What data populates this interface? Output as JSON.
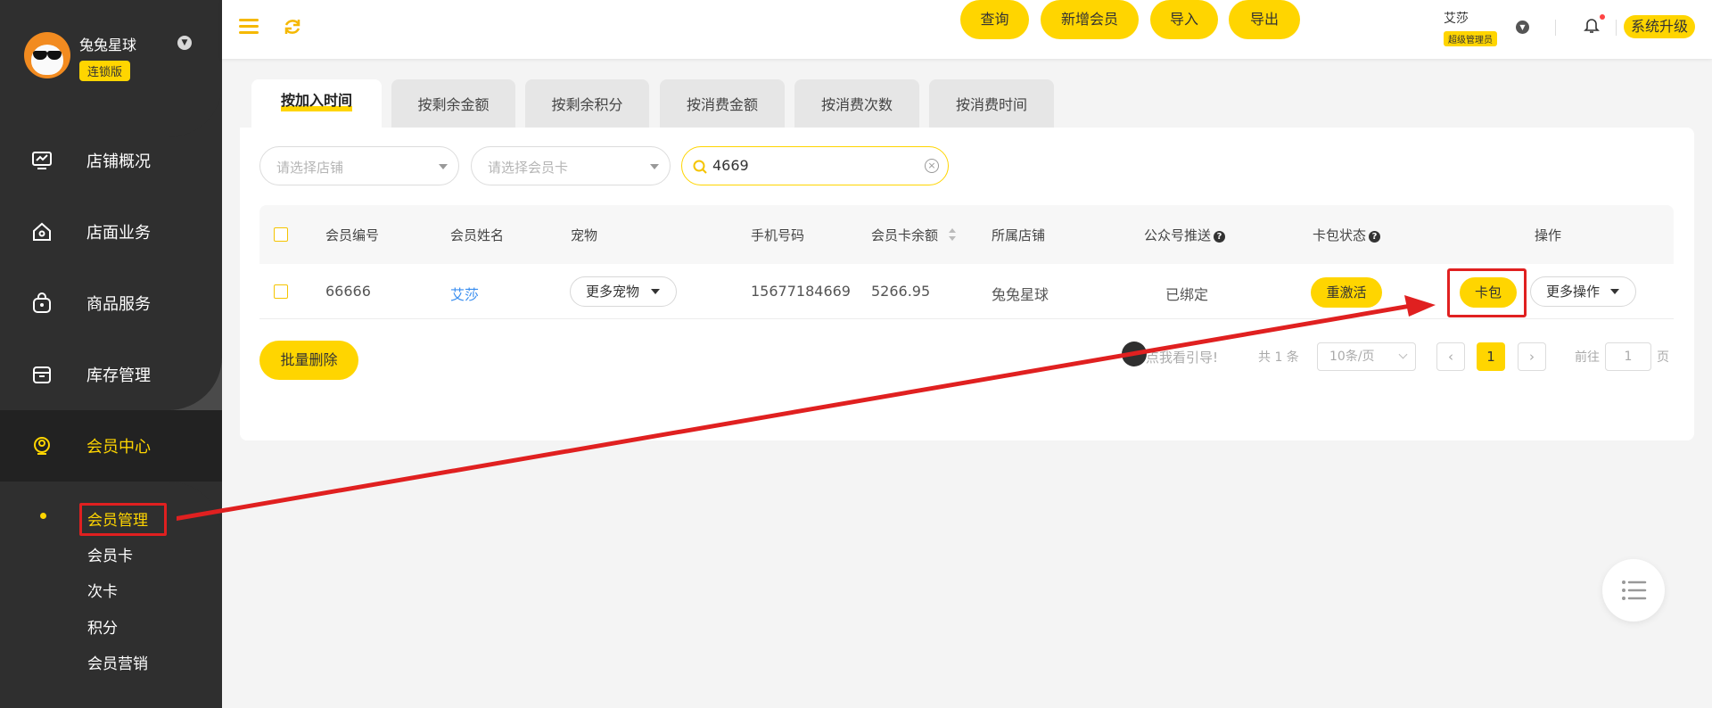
{
  "brand": {
    "name": "兔兔星球",
    "badge": "连锁版"
  },
  "menu": [
    {
      "label": "店铺概况",
      "icon": "monitor-icon"
    },
    {
      "label": "店面业务",
      "icon": "house-icon"
    },
    {
      "label": "商品服务",
      "icon": "bag-icon"
    },
    {
      "label": "库存管理",
      "icon": "box-icon"
    },
    {
      "label": "会员中心",
      "icon": "member-icon"
    }
  ],
  "submenu": [
    "会员管理",
    "会员卡",
    "次卡",
    "积分",
    "会员营销"
  ],
  "header": {
    "user_name": "艾莎",
    "user_role": "超级管理员",
    "upgrade": "系统升级"
  },
  "tabs": [
    "按加入时间",
    "按剩余金额",
    "按剩余积分",
    "按消费金额",
    "按消费次数",
    "按消费时间"
  ],
  "filters": {
    "store_placeholder": "请选择店铺",
    "card_placeholder": "请选择会员卡",
    "search_value": "4669",
    "query": "查询",
    "add_member": "新增会员",
    "import": "导入",
    "export": "导出"
  },
  "table": {
    "headers": [
      "会员编号",
      "会员姓名",
      "宠物",
      "手机号码",
      "会员卡余额",
      "所属店铺",
      "公众号推送",
      "卡包状态",
      "操作"
    ],
    "row": {
      "id": "66666",
      "name": "艾莎",
      "pets": "更多宠物",
      "phone": "15677184669",
      "balance": "5266.95",
      "store": "兔兔星球",
      "push": "已绑定",
      "card_status": "重激活",
      "card_pack": "卡包",
      "more_ops": "更多操作"
    }
  },
  "bulk_delete": "批量删除",
  "pagination": {
    "guide": "点我看引导!",
    "total": "共 1 条",
    "page_size": "10条/页",
    "current": "1",
    "goto_label": "前往",
    "goto_value": "1",
    "page_suffix": "页"
  },
  "colors": {
    "accent": "#ffd500",
    "sidebar": "#2f2f2f",
    "annotation": "#e02020",
    "link": "#3b8ff0"
  }
}
